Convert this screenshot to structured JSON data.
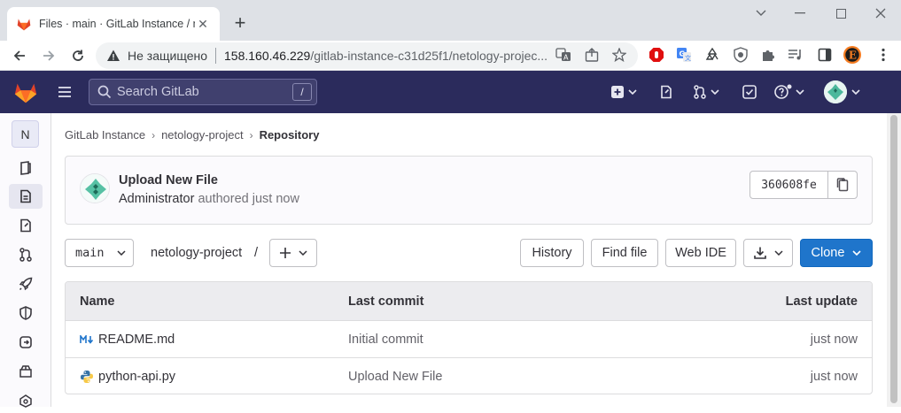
{
  "browser": {
    "tab_title": "Files · main · GitLab Instance / netology-project",
    "new_tab": "+",
    "security_label": "Не защищено",
    "url_host": "158.160.46.229",
    "url_path": "/gitlab-instance-c31d25f1/netology-projec..."
  },
  "gitlab": {
    "search_placeholder": "Search GitLab",
    "search_shortcut": "/",
    "project_initial": "N"
  },
  "breadcrumb": [
    "GitLab Instance",
    "netology-project",
    "Repository"
  ],
  "commit": {
    "title": "Upload New File",
    "author": "Administrator",
    "meta": "authored just now",
    "sha": "360608fe"
  },
  "repo_toolbar": {
    "branch": "main",
    "project_path": "netology-project",
    "path_sep": "/",
    "history": "History",
    "find_file": "Find file",
    "web_ide": "Web IDE",
    "clone": "Clone"
  },
  "file_table": {
    "headers": {
      "name": "Name",
      "last_commit": "Last commit",
      "last_update": "Last update"
    },
    "rows": [
      {
        "icon": "markdown-icon",
        "name": "README.md",
        "commit": "Initial commit",
        "updated": "just now"
      },
      {
        "icon": "python-icon",
        "name": "python-api.py",
        "commit": "Upload New File",
        "updated": "just now"
      }
    ]
  },
  "colors": {
    "header_bg": "#2b2b5c",
    "primary": "#1f75cb",
    "gitlab_orange": "#fc6d26"
  }
}
